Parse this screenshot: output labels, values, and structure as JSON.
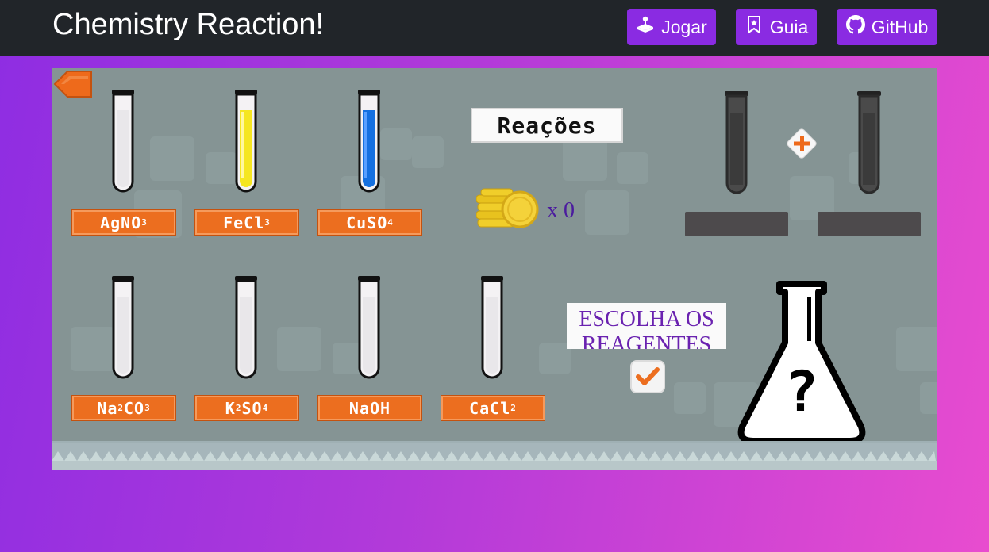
{
  "navbar": {
    "brand": "Chemistry Reaction!",
    "buttons": [
      {
        "label": "Jogar",
        "icon": "joystick-icon"
      },
      {
        "label": "Guia",
        "icon": "bookmark-icon"
      },
      {
        "label": "GitHub",
        "icon": "github-icon"
      }
    ],
    "accent_color": "#8a2be2",
    "background_color": "#212529"
  },
  "game": {
    "reagents_top": [
      {
        "formula": "AgNO",
        "sub": "3",
        "liquid": "#e9e7ea"
      },
      {
        "formula": "FeCl",
        "sub": "3",
        "liquid": "#f5e621"
      },
      {
        "formula": "CuSO",
        "sub": "4",
        "liquid": "#1570e0"
      }
    ],
    "reagents_bottom": [
      {
        "parts": [
          "Na",
          "2",
          "CO",
          "3"
        ]
      },
      {
        "parts": [
          "K",
          "2",
          "SO",
          "4"
        ]
      },
      {
        "parts": [
          "NaOH"
        ]
      },
      {
        "parts": [
          "CaCl",
          "2"
        ]
      }
    ],
    "reactions_button": "Reações",
    "coins": {
      "prefix": "x",
      "count": "0"
    },
    "choose_text": "ESCOLHA OS REAGENTES",
    "label_color": "#ec6e1f",
    "background_color": "#859494"
  }
}
